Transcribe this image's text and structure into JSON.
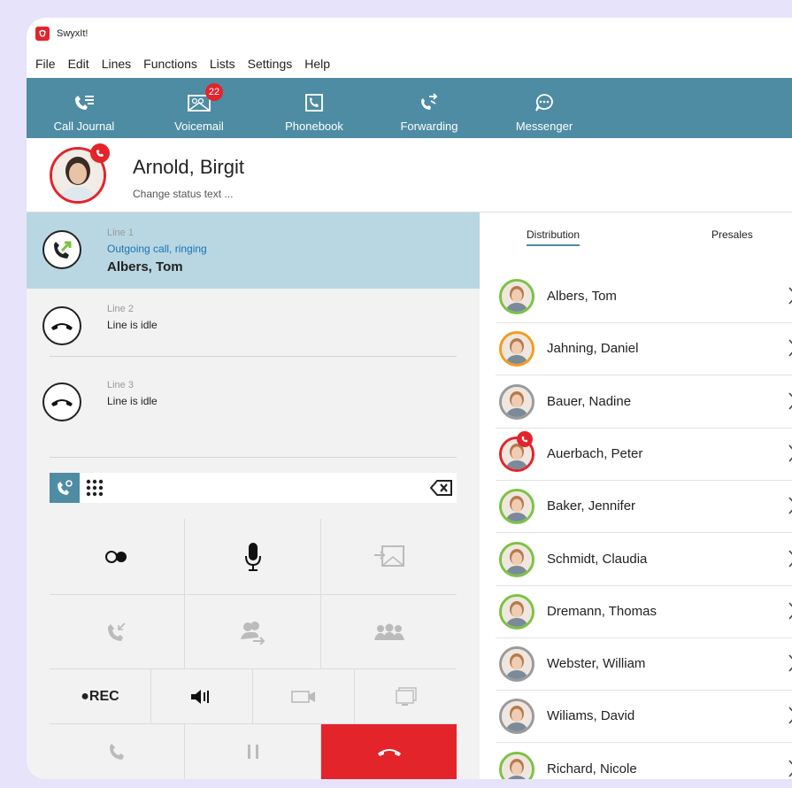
{
  "app": {
    "title": "SwyxIt!"
  },
  "menu": [
    "File",
    "Edit",
    "Lines",
    "Functions",
    "Lists",
    "Settings",
    "Help"
  ],
  "toolbar": [
    {
      "label": "Call Journal",
      "icon": "call-journal-icon"
    },
    {
      "label": "Voicemail",
      "icon": "voicemail-icon",
      "badge": "22"
    },
    {
      "label": "Phonebook",
      "icon": "phonebook-icon"
    },
    {
      "label": "Forwarding",
      "icon": "forwarding-icon"
    },
    {
      "label": "Messenger",
      "icon": "messenger-icon"
    }
  ],
  "profile": {
    "name": "Arnold, Birgit",
    "status_text": "Change status text ..."
  },
  "lines": [
    {
      "label": "Line 1",
      "status": "Outgoing call, ringing",
      "contact": "Albers, Tom",
      "active": true
    },
    {
      "label": "Line 2",
      "status": "Line is idle"
    },
    {
      "label": "Line 3",
      "status": "Line is idle"
    }
  ],
  "controls": {
    "rec_label": "●REC"
  },
  "tabs": [
    {
      "label": "Distribution",
      "active": true
    },
    {
      "label": "Presales"
    }
  ],
  "contacts": [
    {
      "name": "Albers, Tom",
      "status": "available"
    },
    {
      "name": "Jahning, Daniel",
      "status": "away"
    },
    {
      "name": "Bauer, Nadine",
      "status": "offline"
    },
    {
      "name": "Auerbach, Peter",
      "status": "on-call"
    },
    {
      "name": "Baker, Jennifer",
      "status": "available"
    },
    {
      "name": "Schmidt, Claudia",
      "status": "available"
    },
    {
      "name": "Dremann, Thomas",
      "status": "available"
    },
    {
      "name": "Webster, William",
      "status": "offline"
    },
    {
      "name": "Wiliams, David",
      "status": "offline"
    },
    {
      "name": "Richard, Nicole",
      "status": "available"
    }
  ],
  "colors": {
    "accent": "#4e8ca3",
    "danger": "#e3242b",
    "available": "#7cc242",
    "away": "#f39c1e",
    "offline": "#9a9a9a",
    "on_call": "#e3242b",
    "active_line": "#b9d7e2"
  }
}
